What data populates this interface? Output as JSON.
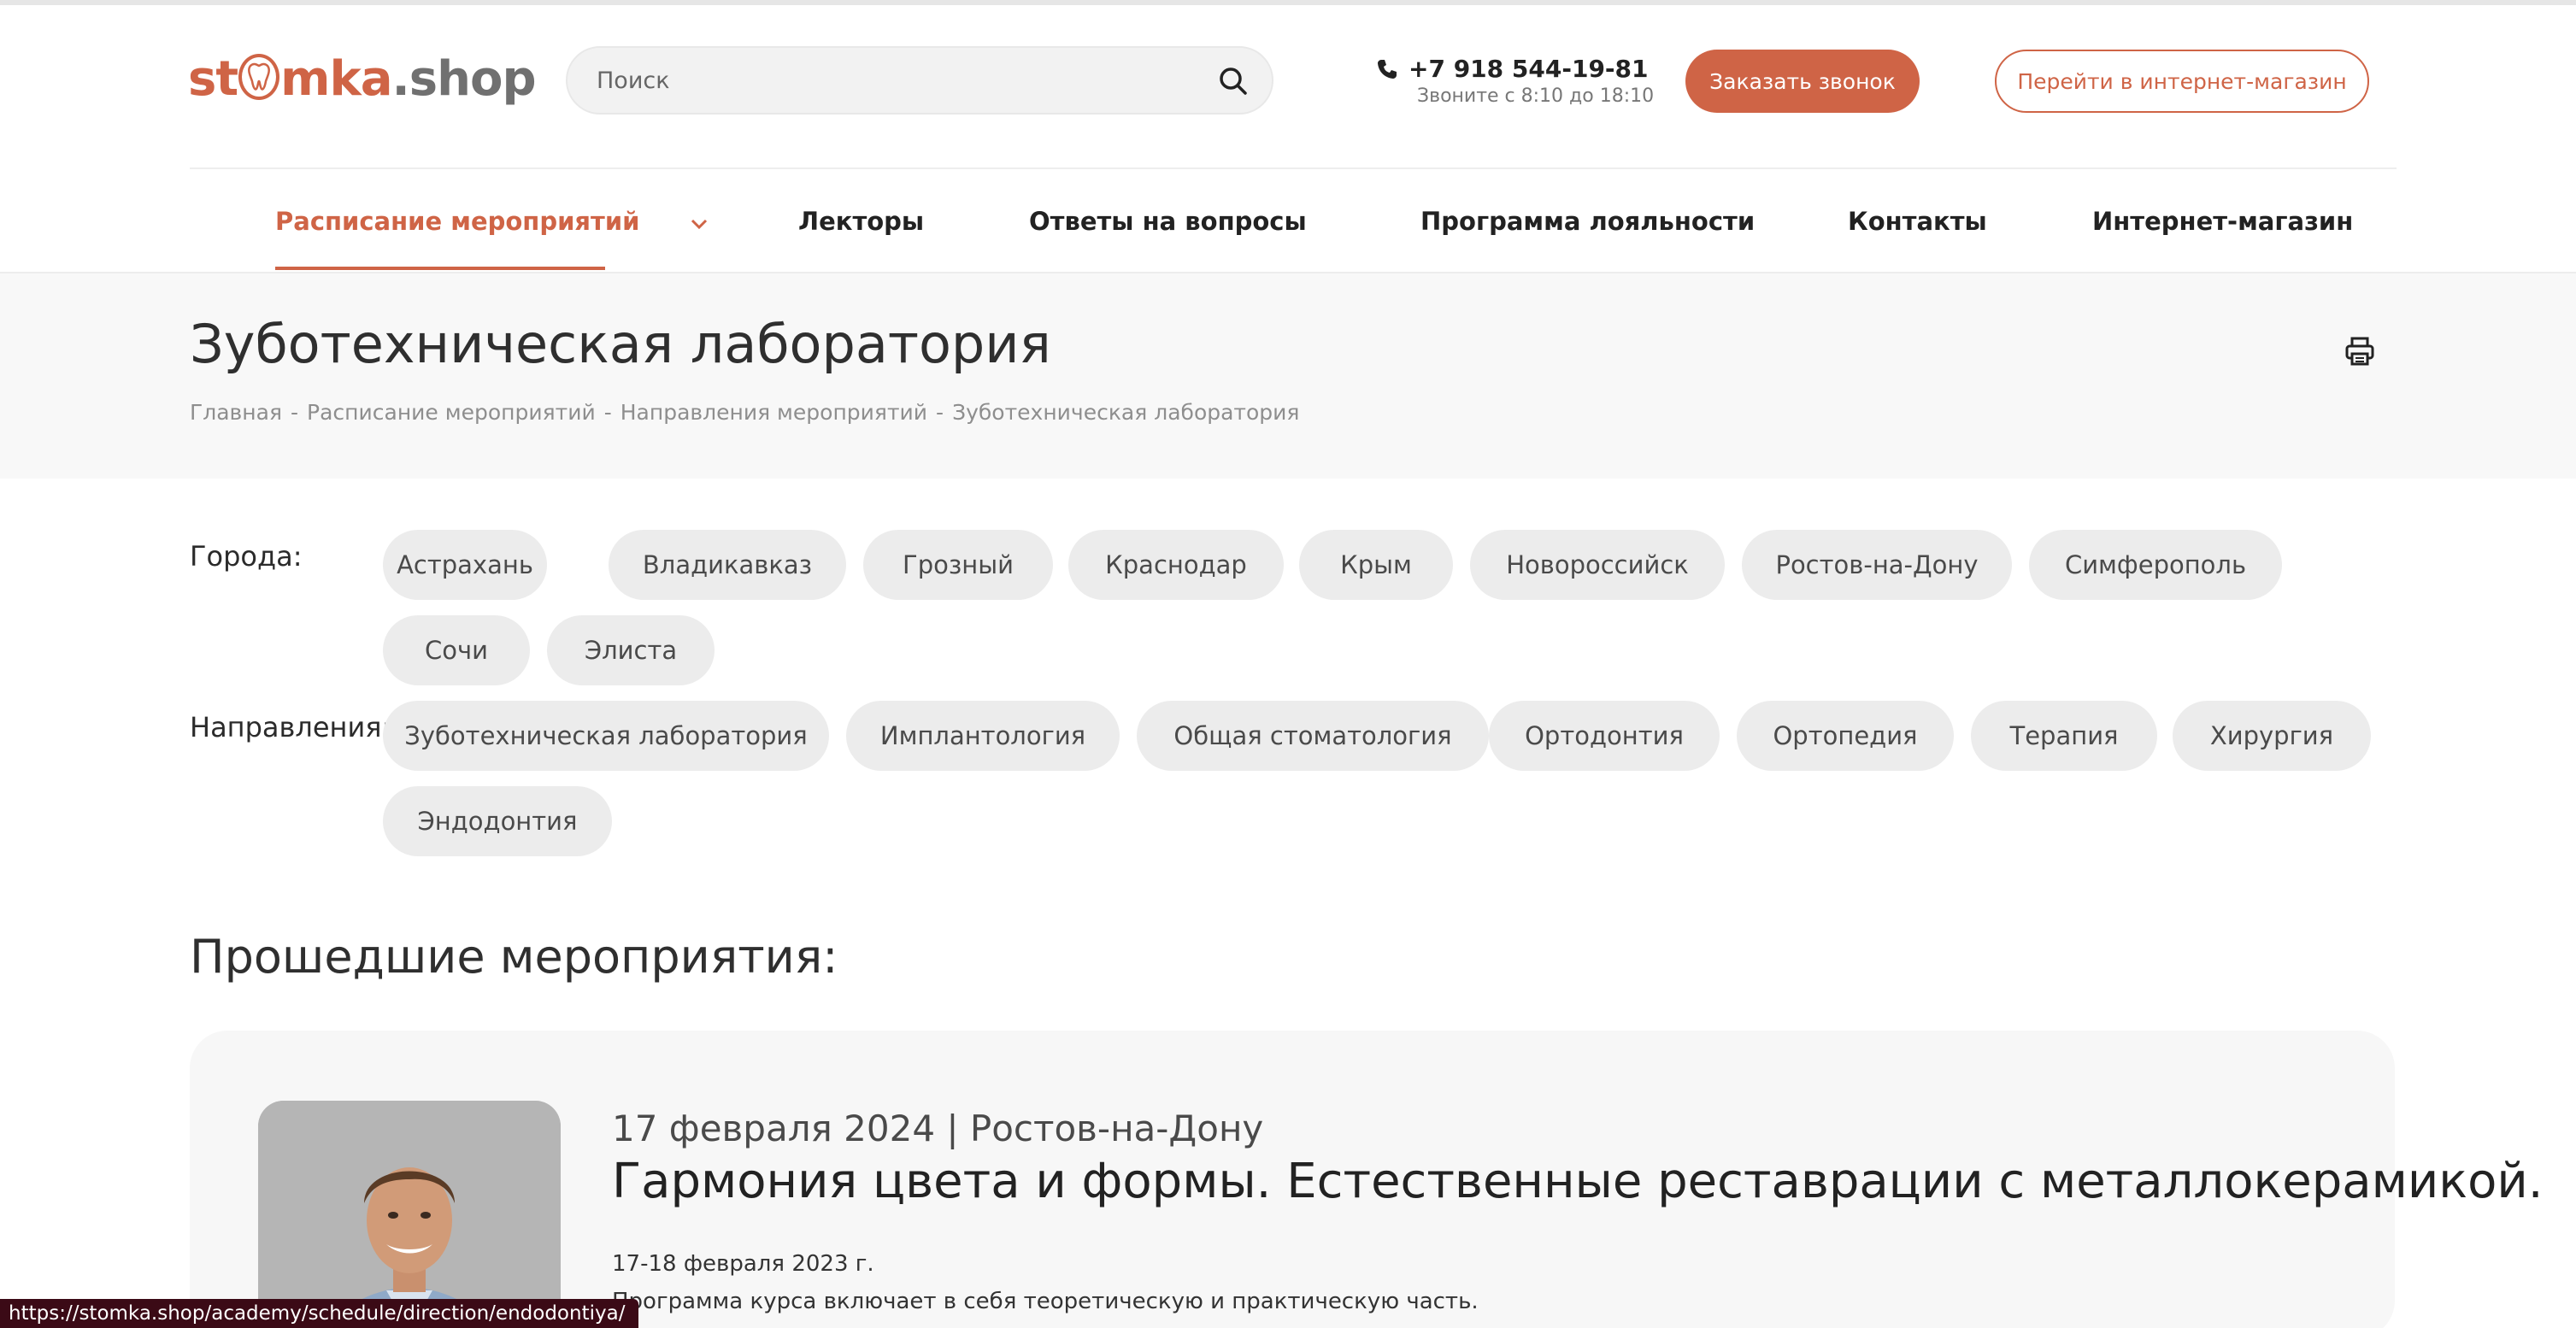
{
  "header": {
    "logo": {
      "part1": "st",
      "part2": "mka",
      "part3": ".shop"
    },
    "search": {
      "placeholder": "Поиск"
    },
    "phone": {
      "number": "+7 918 544-19-81",
      "hours": "Звоните с 8:10 до 18:10"
    },
    "callback_label": "Заказать звонок",
    "shop_label": "Перейти в интернет-магазин",
    "accent_color": "#cf6446"
  },
  "nav": {
    "items": [
      {
        "label": "Расписание мероприятий",
        "active": true
      },
      {
        "label": "Лекторы"
      },
      {
        "label": "Ответы на вопросы"
      },
      {
        "label": "Программа лояльности"
      },
      {
        "label": "Контакты"
      },
      {
        "label": "Интернет-магазин"
      }
    ]
  },
  "page": {
    "title": "Зуботехническая лаборатория",
    "breadcrumb": [
      "Главная",
      "Расписание мероприятий",
      "Направления мероприятий",
      "Зуботехническая лаборатория"
    ],
    "breadcrumb_separator": "-"
  },
  "filters": {
    "cities_label": "Города:",
    "cities": [
      "Астрахань",
      "Владикавказ",
      "Грозный",
      "Краснодар",
      "Крым",
      "Новороссийск",
      "Ростов-на-Дону",
      "Симферополь",
      "Сочи",
      "Элиста"
    ],
    "directions_label": "Направления:",
    "directions": [
      "Зуботехническая лаборатория",
      "Имплантология",
      "Общая стоматология",
      "Ортодонтия",
      "Ортопедия",
      "Терапия",
      "Хирургия",
      "Эндодонтия"
    ]
  },
  "past_events": {
    "title": "Прошедшие мероприятия:",
    "items": [
      {
        "meta": "17 февраля 2024 | Ростов-на-Дону",
        "title": "Гармония цвета и формы. Естественные реставрации с металлокерамикой.",
        "dates": "17-18 февраля 2023 г.",
        "description": "Программа курса включает в себя теоретическую и практическую часть."
      }
    ]
  },
  "status_bar": {
    "url": "https://stomka.shop/academy/schedule/direction/endodontiya/"
  }
}
